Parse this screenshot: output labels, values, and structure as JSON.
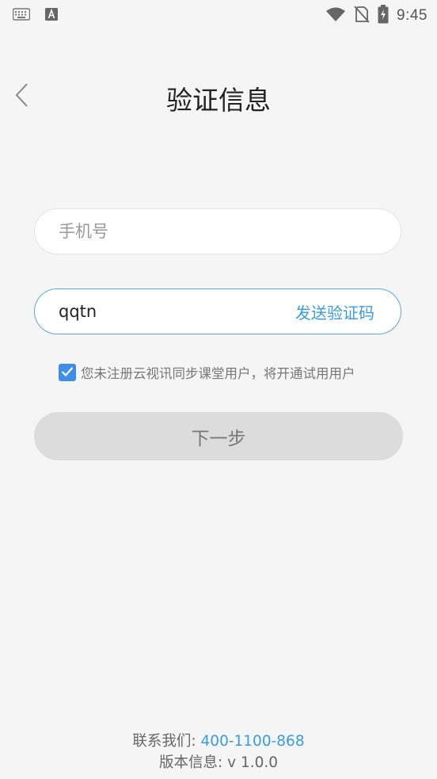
{
  "status_bar": {
    "time": "9:45",
    "left_icons": [
      "keyboard-icon",
      "font-icon"
    ],
    "right_icons": [
      "wifi-icon",
      "no-sim-icon",
      "battery-charging-icon"
    ]
  },
  "header": {
    "back_icon": "chevron-left-icon",
    "title": "验证信息"
  },
  "form": {
    "phone": {
      "placeholder": "手机号",
      "value": ""
    },
    "code": {
      "value": "qqtn",
      "send_label": "发送验证码"
    },
    "agreement": {
      "checked": true,
      "text": "您未注册云视讯同步课堂用户，将开通试用用户"
    },
    "next_label": "下一步"
  },
  "footer": {
    "contact_label": "联系我们: ",
    "contact_number": "400-1100-868",
    "version_label": "版本信息: ",
    "version": "v 1.0.0"
  },
  "colors": {
    "accent": "#3a9be0",
    "checkbox": "#3f8ee6",
    "background": "#f5f5f5",
    "next_button": "#dcdcdc"
  }
}
